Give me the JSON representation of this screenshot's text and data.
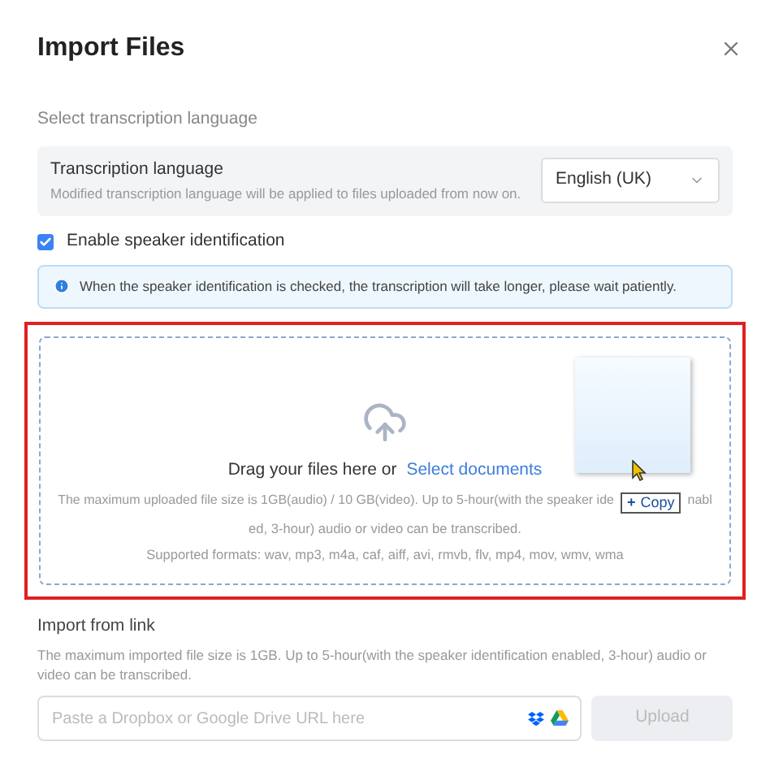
{
  "dialog": {
    "title": "Import Files"
  },
  "language_section": {
    "heading": "Select transcription language",
    "label": "Transcription language",
    "description": "Modified transcription language will be applied to files uploaded from now on.",
    "select_value": "English (UK)"
  },
  "speaker_identification": {
    "label": "Enable speaker identification",
    "checked": true
  },
  "notice": "When the speaker identification is checked, the transcription will take longer, please wait patiently.",
  "drop_zone": {
    "highlighted": true,
    "prompt": "Drag your files here or",
    "link": "Select documents",
    "size_note_start": "The maximum uploaded file size is 1GB(audio) / 10 GB(video). Up to 5-hour(with the speaker ide",
    "size_note_after_cursor": "nabl",
    "size_note_line_2": "ed, 3-hour) audio or video can be transcribed.",
    "formats": "Supported formats: wav, mp3, m4a, caf, aiff, avi, rmvb, flv, mp4, mov, wmv, wma",
    "drag_tooltip": {
      "symbol": "+",
      "label": "Copy"
    }
  },
  "link_import": {
    "heading": "Import from link",
    "note": "The maximum imported file size is 1GB. Up to 5-hour(with the speaker identification enabled, 3-hour) audio or video can be transcribed.",
    "placeholder": "Paste a Dropbox or Google Drive URL here",
    "button": "Upload",
    "button_disabled": true
  }
}
